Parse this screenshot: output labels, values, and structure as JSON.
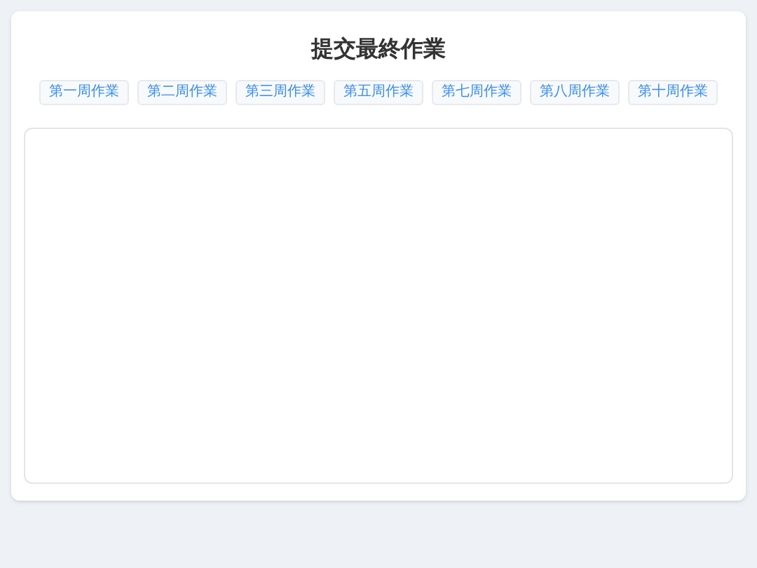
{
  "title": "提交最終作業",
  "tabs": [
    {
      "label": "第一周作業"
    },
    {
      "label": "第二周作業"
    },
    {
      "label": "第三周作業"
    },
    {
      "label": "第五周作業"
    },
    {
      "label": "第七周作業"
    },
    {
      "label": "第八周作業"
    },
    {
      "label": "第十周作業"
    }
  ]
}
